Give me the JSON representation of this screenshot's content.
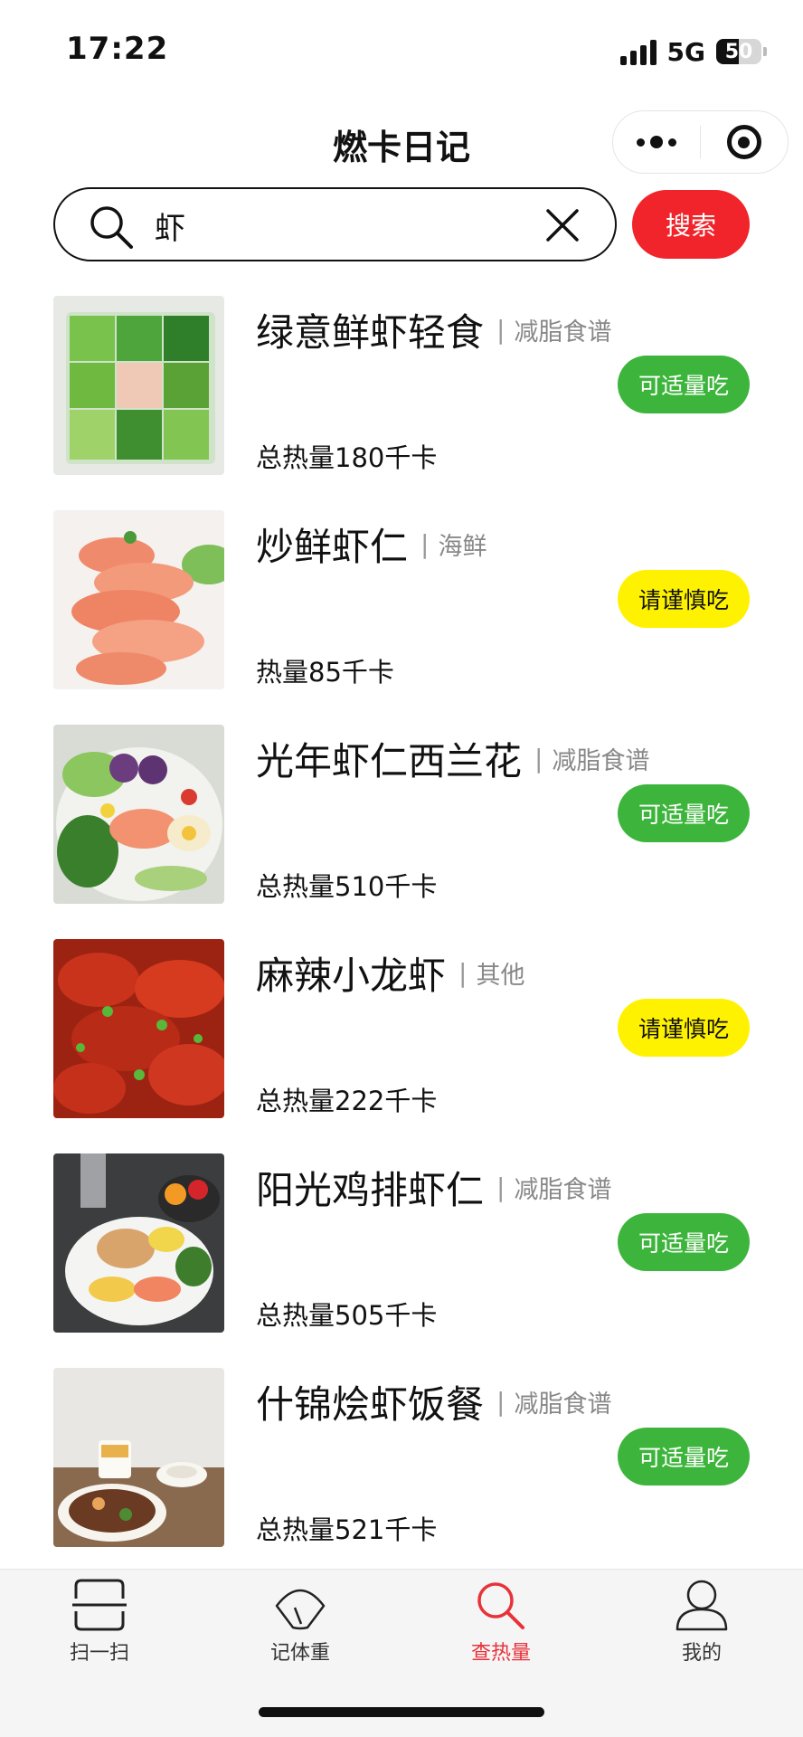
{
  "status_bar": {
    "time": "17:22",
    "network": "5G",
    "battery": "50",
    "battery_level": 0.5
  },
  "nav": {
    "title": "燃卡日记"
  },
  "search": {
    "value": "虾",
    "button_label": "搜索"
  },
  "colors": {
    "accent": "#f0242a",
    "safe": "#3db53c",
    "caution": "#fff200",
    "active_tab": "#e8323a"
  },
  "food_list": [
    {
      "name": "绿意鲜虾轻食",
      "separator": "|",
      "category": "减脂食谱",
      "tag": "可适量吃",
      "tag_color": "green",
      "calories": "总热量180千卡",
      "image": "salad-greens-shrimp"
    },
    {
      "name": "炒鲜虾仁",
      "separator": "|",
      "category": "海鲜",
      "tag": "请谨慎吃",
      "tag_color": "yellow",
      "calories": "热量85千卡",
      "image": "shrimp"
    },
    {
      "name": "光年虾仁西兰花",
      "separator": "|",
      "category": "减脂食谱",
      "tag": "可适量吃",
      "tag_color": "green",
      "calories": "总热量510千卡",
      "image": "shrimp-broccoli-bowl"
    },
    {
      "name": "麻辣小龙虾",
      "separator": "|",
      "category": "其他",
      "tag": "请谨慎吃",
      "tag_color": "yellow",
      "calories": "总热量222千卡",
      "image": "crayfish"
    },
    {
      "name": "阳光鸡排虾仁",
      "separator": "|",
      "category": "减脂食谱",
      "tag": "可适量吃",
      "tag_color": "green",
      "calories": "总热量505千卡",
      "image": "chicken-shrimp-plate"
    },
    {
      "name": "什锦烩虾饭餐",
      "separator": "|",
      "category": "减脂食谱",
      "tag": "可适量吃",
      "tag_color": "green",
      "calories": "总热量521千卡",
      "image": "shrimp-rice-meal"
    }
  ],
  "tab_bar": {
    "tabs": [
      {
        "label": "扫一扫",
        "icon": "scan-icon",
        "active": false
      },
      {
        "label": "记体重",
        "icon": "scale-icon",
        "active": false
      },
      {
        "label": "查热量",
        "icon": "search-icon",
        "active": true
      },
      {
        "label": "我的",
        "icon": "user-icon",
        "active": false
      }
    ]
  }
}
